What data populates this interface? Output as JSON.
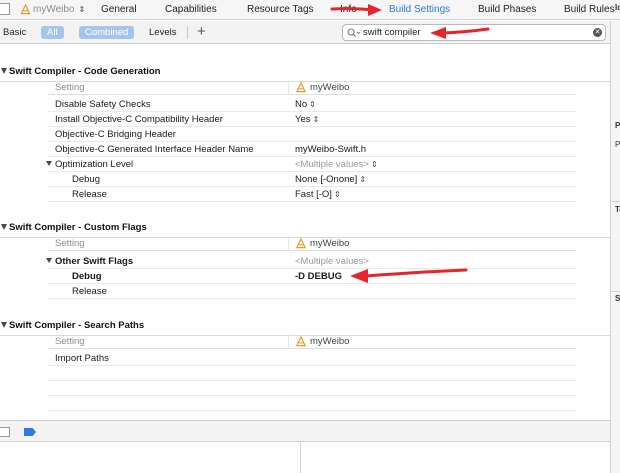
{
  "tabbar": {
    "target_name": "myWeibo",
    "tabs": [
      {
        "label": "General"
      },
      {
        "label": "Capabilities"
      },
      {
        "label": "Resource Tags"
      },
      {
        "label": "Info"
      },
      {
        "label": "Build Settings"
      },
      {
        "label": "Build Phases"
      },
      {
        "label": "Build Rules"
      }
    ],
    "active_tab": "Build Settings"
  },
  "filterbar": {
    "basic": "Basic",
    "all": "All",
    "combined": "Combined",
    "levels": "Levels",
    "add": "+",
    "search_value": "swift compiler"
  },
  "right_panel": {
    "labels": [
      "Id",
      "P",
      "P",
      "Te",
      "So"
    ]
  },
  "column_header": {
    "setting": "Setting",
    "target": "myWeibo"
  },
  "sections": [
    {
      "title": "Swift Compiler - Code Generation",
      "rows": [
        {
          "key": "Disable Safety Checks",
          "value": "No"
        },
        {
          "key": "Install Objective-C Compatibility Header",
          "value": "Yes"
        },
        {
          "key": "Objective-C Bridging Header",
          "value": ""
        },
        {
          "key": "Objective-C Generated Interface Header Name",
          "value": "myWeibo-Swift.h"
        },
        {
          "key": "Optimization Level",
          "value": "<Multiple values>"
        },
        {
          "key": "Debug",
          "value": "None [-Onone]"
        },
        {
          "key": "Release",
          "value": "Fast [-O]"
        }
      ]
    },
    {
      "title": "Swift Compiler - Custom Flags",
      "rows": [
        {
          "key": "Other Swift Flags",
          "value": "<Multiple values>"
        },
        {
          "key": "Debug",
          "value": "-D DEBUG"
        },
        {
          "key": "Release",
          "value": ""
        }
      ]
    },
    {
      "title": "Swift Compiler - Search Paths",
      "rows": [
        {
          "key": "Import Paths",
          "value": ""
        }
      ]
    }
  ],
  "colors": {
    "accent": "#2a7ae2",
    "pill": "#a6c5ec",
    "annotation_arrow": "#e5242b"
  }
}
